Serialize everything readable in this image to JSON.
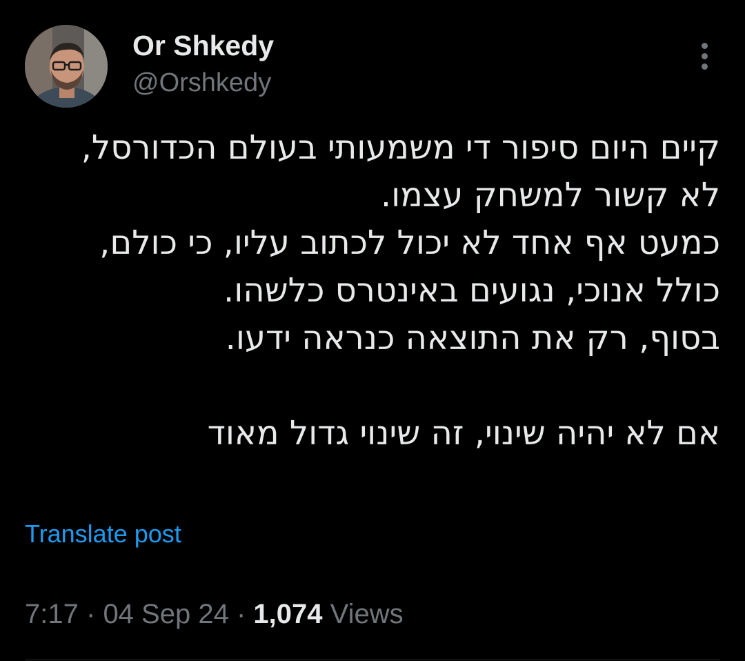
{
  "post": {
    "author": {
      "display_name": "Or Shkedy",
      "handle": "@Orshkedy",
      "avatar_icon": "profile-photo"
    },
    "more_icon": "more-vertical-icon",
    "text_lines": [
      "קיים היום סיפור די משמעותי בעולם הכדורסל,",
      "לא קשור למשחק עצמו.",
      "כמעט אף אחד לא יכול לכתוב עליו, כי כולם,",
      "כולל אנוכי, נגועים באינטרס כלשהו.",
      "בסוף, רק את התוצאה כנראה ידעו.",
      "",
      "אם לא יהיה שינוי, זה שינוי גדול מאוד"
    ],
    "translate_label": "Translate post",
    "meta": {
      "time": "7:17",
      "separator": "·",
      "date": "04 Sep 24",
      "views_count": "1,074",
      "views_label": "Views"
    }
  },
  "colors": {
    "background": "#000000",
    "text_primary": "#e7e9ea",
    "text_secondary": "#71767b",
    "link": "#1d9bf0",
    "divider": "#2f3336"
  }
}
